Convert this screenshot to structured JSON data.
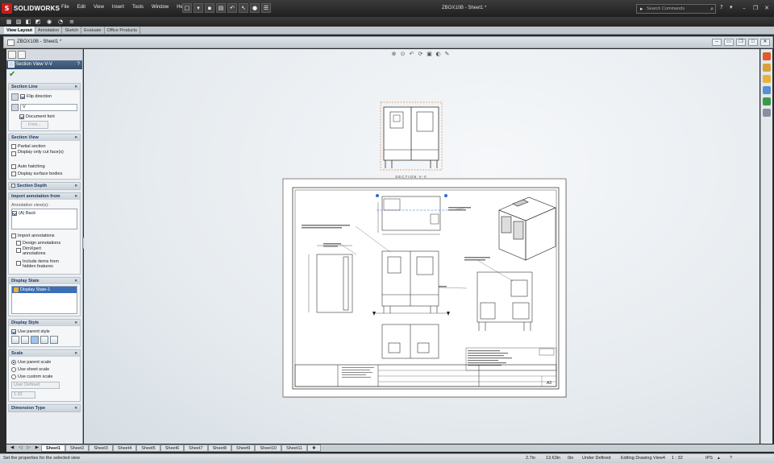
{
  "app": {
    "logo_text": "SOLIDWORKS",
    "doc_title": "ZBOX10B - Sheet1 *"
  },
  "menu": [
    "File",
    "Edit",
    "View",
    "Insert",
    "Tools",
    "Window",
    "Help"
  ],
  "search": {
    "placeholder": "Search Commands"
  },
  "command_tabs": [
    {
      "label": "View Layout",
      "active": true
    },
    {
      "label": "Annotation",
      "active": false
    },
    {
      "label": "Sketch",
      "active": false
    },
    {
      "label": "Evaluate",
      "active": false
    },
    {
      "label": "Office Products",
      "active": false
    }
  ],
  "document_window": {
    "title": "ZBOX10B - Sheet1 *"
  },
  "property_manager": {
    "title": "Section View V-V",
    "help": "?",
    "section_line": {
      "header": "Section Line",
      "flip_direction": "Flip direction",
      "label_value": "V",
      "document_font": "Document font",
      "font_button": "Font..."
    },
    "section_view": {
      "header": "Section View",
      "options": [
        "Partial section",
        "Display only cut face(s)",
        "Auto hatching",
        "Display surface bodies"
      ]
    },
    "section_depth": {
      "header": "Section Depth"
    },
    "import_annotation": {
      "header": "Import annotation from",
      "list_label": "Annotation view(s):",
      "list_item": "(A) Back",
      "options": [
        "Import annotations",
        "Design annotations",
        "DimXpert annotations",
        "Include items from hidden features"
      ]
    },
    "display_state": {
      "header": "Display State",
      "item": "Display State-1"
    },
    "display_style": {
      "header": "Display Style",
      "use_parent": "Use parent style"
    },
    "scale": {
      "header": "Scale",
      "options": [
        "Use parent scale",
        "Use sheet scale",
        "Use custom scale"
      ],
      "selected": "User Defined",
      "custom_value": "1:32"
    },
    "dimension_type": {
      "header": "Dimension Type"
    }
  },
  "drawing": {
    "section_label": "SECTION V-V",
    "title_block_text": "A3"
  },
  "sheet_tabs": [
    "Sheet1",
    "Sheet2",
    "Sheet3",
    "Sheet4",
    "Sheet5",
    "Sheet6",
    "Sheet7",
    "Sheet8",
    "Sheet9",
    "Sheet10",
    "Sheet11"
  ],
  "status": {
    "message": "Set the properties for the selected view",
    "x": "2.7in",
    "y": "13.63in",
    "z": "0in",
    "state": "Under Defined",
    "editing": "Editing Drawing View4",
    "scale": "1 : 32",
    "units": "IPS"
  }
}
